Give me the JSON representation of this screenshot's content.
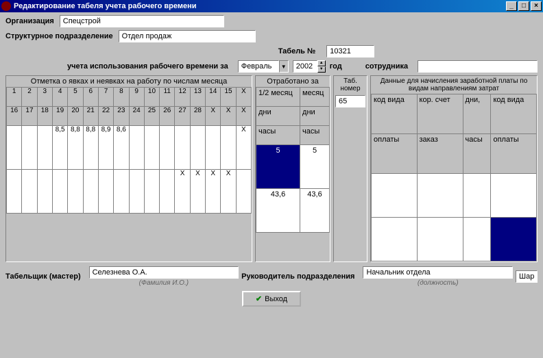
{
  "window": {
    "title": "Редактирование табеля учета рабочего времени"
  },
  "fields": {
    "org_label": "Организация",
    "org_value": "Спецстрой",
    "dept_label": "Структурное подразделение",
    "dept_value": "Отдел продаж",
    "tabel_label": "Табель №",
    "tabel_value": "10321",
    "period_label": "учета использования рабочего времени за",
    "month": "Февраль",
    "year": "2002",
    "year_suffix": "год",
    "employee_label": "сотрудника",
    "employee_value": ""
  },
  "attendance": {
    "header": "Отметка о явках и неявках на работу по числам месяца",
    "row1": [
      "1",
      "2",
      "3",
      "4",
      "5",
      "6",
      "7",
      "8",
      "9",
      "10",
      "11",
      "12",
      "13",
      "14",
      "15",
      "X"
    ],
    "row2": [
      "16",
      "17",
      "18",
      "19",
      "20",
      "21",
      "22",
      "23",
      "24",
      "25",
      "26",
      "27",
      "28",
      "X",
      "X",
      "X"
    ],
    "row3": [
      "",
      "",
      "",
      "8,5",
      "8,8",
      "8,8",
      "8,9",
      "8,6",
      "",
      "",
      "",
      "",
      "",
      "",
      "",
      "X"
    ],
    "row4": [
      "",
      "",
      "",
      "",
      "",
      "",
      "",
      "",
      "",
      "",
      "",
      "X",
      "X",
      "X",
      "X",
      ""
    ]
  },
  "worked": {
    "header": "Отработано за",
    "labels": {
      "half": "1/2 месяц",
      "month": "месяц",
      "days": "дни",
      "days2": "дни",
      "hours": "часы",
      "hours2": "часы"
    },
    "values": {
      "half_days": "5",
      "month_days": "5",
      "half_hours": "43,6",
      "month_hours": "43,6"
    }
  },
  "tabno": {
    "header": "Таб. номер",
    "value": "65"
  },
  "payroll": {
    "header": "Данные для начисления заработной платы по видам направлениям затрат",
    "cols1": [
      "код вида",
      "кор. счет",
      "дни,",
      "код вида"
    ],
    "cols2": [
      "оплаты",
      "заказ",
      "часы",
      "оплаты"
    ]
  },
  "footer": {
    "tab_label": "Табельщик (мастер)",
    "tab_value": "Селезнева О.А.",
    "tab_sub": "(Фамилия И.О.)",
    "head_label": "Руководитель подразделения",
    "head_value": "Начальник отдела",
    "head_sub": "(должность)",
    "extra": "Шар"
  },
  "exit_label": "Выход"
}
